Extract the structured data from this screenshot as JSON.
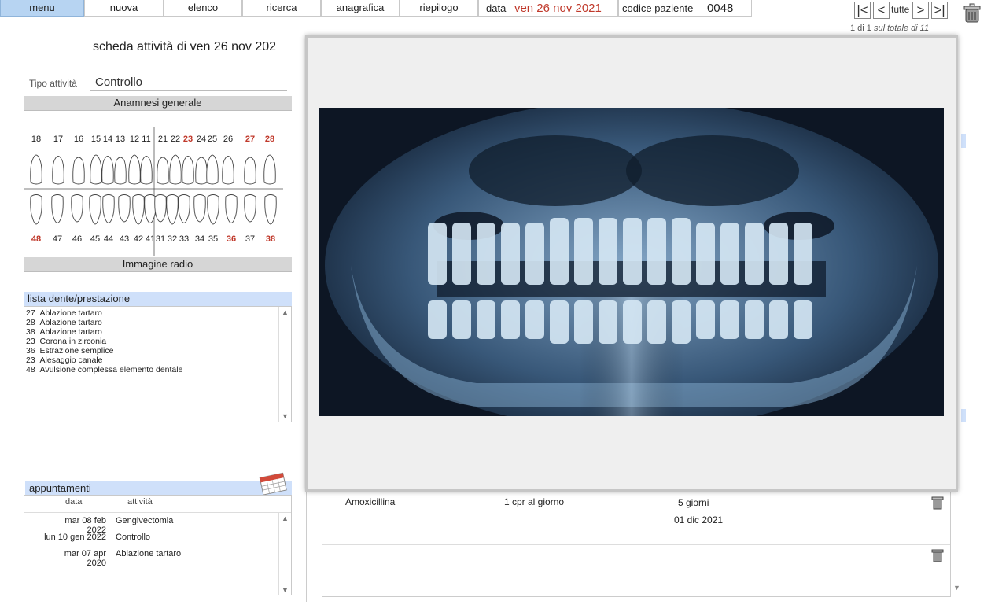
{
  "topnav": {
    "menu": "menu",
    "nuova": "nuova",
    "elenco": "elenco",
    "ricerca": "ricerca",
    "anagrafica": "anagrafica",
    "riepilogo": "riepilogo"
  },
  "header": {
    "data_label": "data",
    "data_value": "ven 26 nov 2021",
    "codice_label": "codice paziente",
    "codice_value": "0048"
  },
  "pager": {
    "first": "|<",
    "prev": "<",
    "all": "tutte",
    "next": ">",
    "last": ">|",
    "status_prefix": "1 di 1",
    "status_suffix": "sul totale di 11"
  },
  "page": {
    "title": "scheda attività di ven 26 nov 202"
  },
  "tipo": {
    "label": "Tipo attività",
    "value": "Controllo"
  },
  "sections": {
    "anamnesi": "Anamnesi generale",
    "immagine": "Immagine radio"
  },
  "teeth": {
    "upper": [
      {
        "n": "18",
        "red": false
      },
      {
        "n": "17",
        "red": false
      },
      {
        "n": "16",
        "red": false
      },
      {
        "n": "15",
        "red": false
      },
      {
        "n": "14",
        "red": false
      },
      {
        "n": "13",
        "red": false
      },
      {
        "n": "12",
        "red": false
      },
      {
        "n": "11",
        "red": false
      },
      {
        "n": "21",
        "red": false
      },
      {
        "n": "22",
        "red": false
      },
      {
        "n": "23",
        "red": true
      },
      {
        "n": "24",
        "red": false
      },
      {
        "n": "25",
        "red": false
      },
      {
        "n": "26",
        "red": false
      },
      {
        "n": "27",
        "red": true
      },
      {
        "n": "28",
        "red": true
      }
    ],
    "lower": [
      {
        "n": "48",
        "red": true
      },
      {
        "n": "47",
        "red": false
      },
      {
        "n": "46",
        "red": false
      },
      {
        "n": "45",
        "red": false
      },
      {
        "n": "44",
        "red": false
      },
      {
        "n": "43",
        "red": false
      },
      {
        "n": "42",
        "red": false
      },
      {
        "n": "41",
        "red": false
      },
      {
        "n": "31",
        "red": false
      },
      {
        "n": "32",
        "red": false
      },
      {
        "n": "33",
        "red": false
      },
      {
        "n": "34",
        "red": false
      },
      {
        "n": "35",
        "red": false
      },
      {
        "n": "36",
        "red": true
      },
      {
        "n": "37",
        "red": false
      },
      {
        "n": "38",
        "red": true
      }
    ]
  },
  "prestazioni": {
    "header": "lista dente/prestazione",
    "rows": [
      "27  Ablazione tartaro",
      "28  Ablazione tartaro",
      "38  Ablazione tartaro",
      "23  Corona in zirconia",
      "36  Estrazione semplice",
      "23  Alesaggio canale",
      "48  Avulsione complessa elemento dentale"
    ]
  },
  "appuntamenti": {
    "header": "appuntamenti",
    "col_data": "data",
    "col_attivita": "attività",
    "rows": [
      {
        "data": "mar 08 feb 2022",
        "attivita": "Gengivectomia"
      },
      {
        "data": "lun 10 gen 2022",
        "attivita": "Controllo"
      },
      {
        "data": "mar 07 apr 2020",
        "attivita": "Ablazione tartaro"
      }
    ]
  },
  "prescrizione": {
    "farmaco": "Amoxicillina",
    "posologia": "1 cpr al giorno",
    "durata": "5 giorni",
    "data": "01 dic 2021"
  },
  "colors": {
    "accent_red": "#c0392b",
    "menu_active": "#b7d4f2",
    "list_header": "#cfe0fa"
  }
}
